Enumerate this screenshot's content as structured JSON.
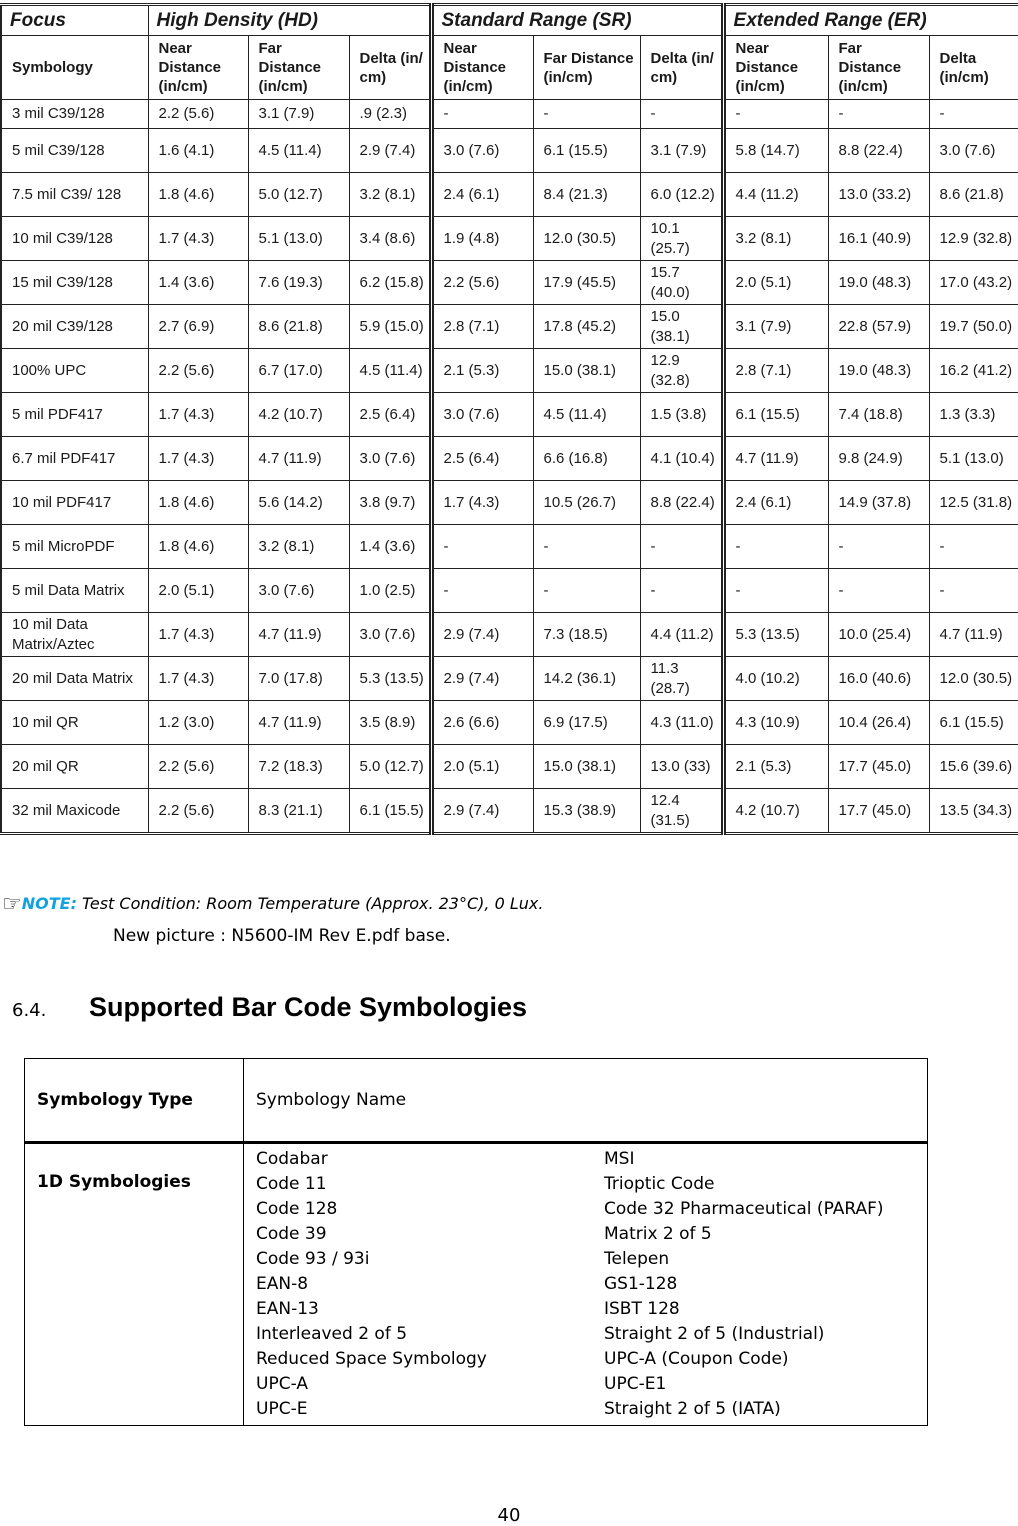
{
  "range_table": {
    "group_headers": [
      "Focus",
      "High Density (HD)",
      "Standard Range (SR)",
      "Extended Range (ER)"
    ],
    "sub_headers": [
      "Symbology",
      "Near Distance (in/cm)",
      "Far Distance (in/cm)",
      "Delta (in/ cm)",
      "Near Distance (in/cm)",
      "Far Distance (in/cm)",
      "Delta (in/ cm)",
      "Near Distance (in/cm)",
      "Far Distance (in/cm)",
      "Delta (in/cm)"
    ],
    "rows": [
      [
        "3 mil C39/128",
        "2.2 (5.6)",
        "3.1 (7.9)",
        ".9 (2.3)",
        "-",
        "-",
        "-",
        "-",
        "-",
        "-"
      ],
      [
        "5 mil C39/128",
        "1.6 (4.1)",
        "4.5 (11.4)",
        "2.9 (7.4)",
        "3.0 (7.6)",
        "6.1 (15.5)",
        "3.1 (7.9)",
        "5.8 (14.7)",
        "8.8 (22.4)",
        "3.0 (7.6)"
      ],
      [
        "7.5 mil C39/ 128",
        "1.8 (4.6)",
        "5.0 (12.7)",
        "3.2 (8.1)",
        "2.4 (6.1)",
        "8.4 (21.3)",
        "6.0 (12.2)",
        "4.4 (11.2)",
        "13.0 (33.2)",
        "8.6 (21.8)"
      ],
      [
        "10 mil C39/128",
        "1.7 (4.3)",
        "5.1 (13.0)",
        "3.4 (8.6)",
        "1.9 (4.8)",
        "12.0 (30.5)",
        "10.1 (25.7)",
        "3.2 (8.1)",
        "16.1 (40.9)",
        "12.9 (32.8)"
      ],
      [
        "15 mil C39/128",
        "1.4 (3.6)",
        "7.6 (19.3)",
        "6.2 (15.8)",
        "2.2 (5.6)",
        "17.9 (45.5)",
        "15.7 (40.0)",
        "2.0 (5.1)",
        "19.0 (48.3)",
        "17.0 (43.2)"
      ],
      [
        "20 mil C39/128",
        "2.7 (6.9)",
        "8.6 (21.8)",
        "5.9 (15.0)",
        "2.8 (7.1)",
        "17.8 (45.2)",
        "15.0 (38.1)",
        "3.1 (7.9)",
        "22.8 (57.9)",
        "19.7 (50.0)"
      ],
      [
        "100% UPC",
        "2.2 (5.6)",
        "6.7 (17.0)",
        "4.5 (11.4)",
        "2.1 (5.3)",
        "15.0 (38.1)",
        "12.9 (32.8)",
        "2.8 (7.1)",
        "19.0 (48.3)",
        "16.2 (41.2)"
      ],
      [
        "5 mil PDF417",
        "1.7 (4.3)",
        "4.2 (10.7)",
        "2.5 (6.4)",
        "3.0 (7.6)",
        "4.5 (11.4)",
        "1.5 (3.8)",
        "6.1 (15.5)",
        "7.4 (18.8)",
        "1.3 (3.3)"
      ],
      [
        "6.7 mil PDF417",
        "1.7 (4.3)",
        "4.7 (11.9)",
        "3.0 (7.6)",
        "2.5 (6.4)",
        "6.6 (16.8)",
        "4.1 (10.4)",
        "4.7 (11.9)",
        "9.8 (24.9)",
        "5.1 (13.0)"
      ],
      [
        "10 mil PDF417",
        "1.8 (4.6)",
        "5.6 (14.2)",
        "3.8 (9.7)",
        "1.7 (4.3)",
        "10.5 (26.7)",
        "8.8 (22.4)",
        "2.4 (6.1)",
        "14.9 (37.8)",
        "12.5 (31.8)"
      ],
      [
        "5 mil MicroPDF",
        "1.8 (4.6)",
        "3.2 (8.1)",
        "1.4 (3.6)",
        "-",
        "-",
        "-",
        "-",
        "-",
        "-"
      ],
      [
        "5 mil Data Matrix",
        "2.0 (5.1)",
        "3.0 (7.6)",
        "1.0 (2.5)",
        "-",
        "-",
        "-",
        "-",
        "-",
        "-"
      ],
      [
        "10 mil Data Matrix/Aztec",
        "1.7 (4.3)",
        "4.7 (11.9)",
        "3.0 (7.6)",
        "2.9 (7.4)",
        "7.3 (18.5)",
        "4.4 (11.2)",
        "5.3 (13.5)",
        "10.0 (25.4)",
        "4.7 (11.9)"
      ],
      [
        "20 mil Data Matrix",
        "1.7 (4.3)",
        "7.0 (17.8)",
        "5.3 (13.5)",
        "2.9 (7.4)",
        "14.2 (36.1)",
        "11.3 (28.7)",
        "4.0 (10.2)",
        "16.0 (40.6)",
        "12.0 (30.5)"
      ],
      [
        "10 mil QR",
        "1.2 (3.0)",
        "4.7 (11.9)",
        "3.5 (8.9)",
        "2.6 (6.6)",
        "6.9 (17.5)",
        "4.3 (11.0)",
        "4.3 (10.9)",
        "10.4 (26.4)",
        "6.1 (15.5)"
      ],
      [
        "20 mil QR",
        "2.2 (5.6)",
        "7.2 (18.3)",
        "5.0 (12.7)",
        "2.0 (5.1)",
        "15.0 (38.1)",
        "13.0 (33)",
        "2.1 (5.3)",
        "17.7 (45.0)",
        "15.6 (39.6)"
      ],
      [
        "32 mil Maxicode",
        "2.2 (5.6)",
        "8.3 (21.1)",
        "6.1 (15.5)",
        "2.9 (7.4)",
        "15.3 (38.9)",
        "12.4 (31.5)",
        "4.2 (10.7)",
        "17.7 (45.0)",
        "13.5 (34.3)"
      ]
    ]
  },
  "note": {
    "icon": "pointing-hand-icon",
    "label": "NOTE:",
    "text": " Test Condition: Room Temperature (Approx. 23°C), 0 Lux.",
    "line2": "New picture : N5600-IM Rev E.pdf base.",
    "label_color": "#12a3dd"
  },
  "section": {
    "number": "6.4.",
    "title": "Supported Bar Code Symbologies"
  },
  "symbology_table": {
    "header_type": "Symbology Type",
    "header_name": "Symbology Name",
    "row_type": "1D Symbologies",
    "left_column": [
      "Codabar",
      "Code 11",
      "Code 128",
      "Code 39",
      "Code 93 / 93i",
      "EAN-8",
      "EAN-13",
      "Interleaved 2 of 5",
      "Reduced Space Symbology",
      "UPC-A",
      "UPC-E"
    ],
    "right_column": [
      "MSI",
      "Trioptic Code",
      "Code 32 Pharmaceutical (PARAF)",
      "Matrix 2 of 5",
      "Telepen",
      "GS1-128",
      "ISBT 128",
      "Straight 2 of 5 (Industrial)",
      "UPC-A (Coupon Code)",
      "UPC-E1",
      "Straight 2 of 5 (IATA)"
    ]
  },
  "page_number": "40"
}
